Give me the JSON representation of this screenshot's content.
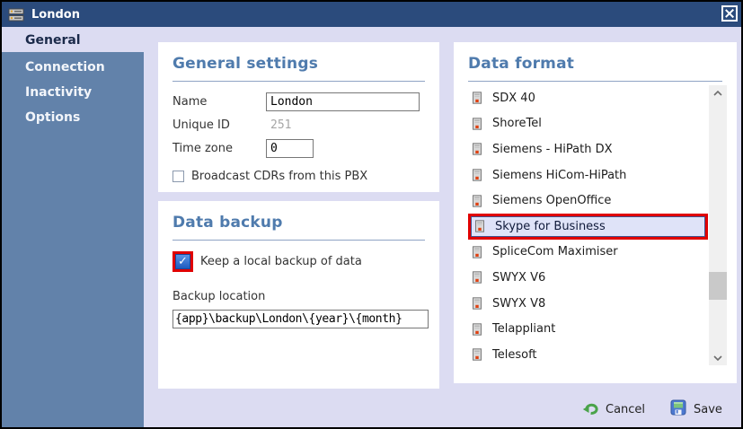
{
  "window": {
    "title": "London"
  },
  "sidebar": {
    "items": [
      {
        "label": "General",
        "selected": true
      },
      {
        "label": "Connection",
        "selected": false
      },
      {
        "label": "Inactivity",
        "selected": false
      },
      {
        "label": "Options",
        "selected": false
      }
    ]
  },
  "general_settings": {
    "title": "General settings",
    "name_label": "Name",
    "name_value": "London",
    "unique_id_label": "Unique ID",
    "unique_id_value": "251",
    "time_zone_label": "Time zone",
    "time_zone_value": "0",
    "broadcast_checkbox_label": "Broadcast CDRs from this PBX",
    "broadcast_checked": false
  },
  "data_backup": {
    "title": "Data backup",
    "keep_checkbox_label": "Keep a local backup of data",
    "keep_checked": true,
    "location_label": "Backup location",
    "location_value": "{app}\\backup\\London\\{year}\\{month}"
  },
  "data_format": {
    "title": "Data format",
    "items": [
      {
        "label": "SDX 40",
        "selected": false
      },
      {
        "label": "ShoreTel",
        "selected": false
      },
      {
        "label": "Siemens - HiPath DX",
        "selected": false
      },
      {
        "label": "Siemens HiCom-HiPath",
        "selected": false
      },
      {
        "label": "Siemens OpenOffice",
        "selected": false
      },
      {
        "label": "Skype for Business",
        "selected": true
      },
      {
        "label": "SpliceCom Maximiser",
        "selected": false
      },
      {
        "label": "SWYX V6",
        "selected": false
      },
      {
        "label": "SWYX V8",
        "selected": false
      },
      {
        "label": "Telappliant",
        "selected": false
      },
      {
        "label": "Telesoft",
        "selected": false
      }
    ]
  },
  "footer": {
    "cancel_label": "Cancel",
    "save_label": "Save"
  },
  "colors": {
    "titlebar": "#2b4b7c",
    "sidebar": "#6282aa",
    "dialog_background": "#dcdcf2",
    "heading": "#4f7bad",
    "selection_background": "#dfe3f8",
    "selection_border": "#42538f",
    "annotation_red": "#e00000",
    "checkbox_checked_blue": "#1d5bbf"
  }
}
